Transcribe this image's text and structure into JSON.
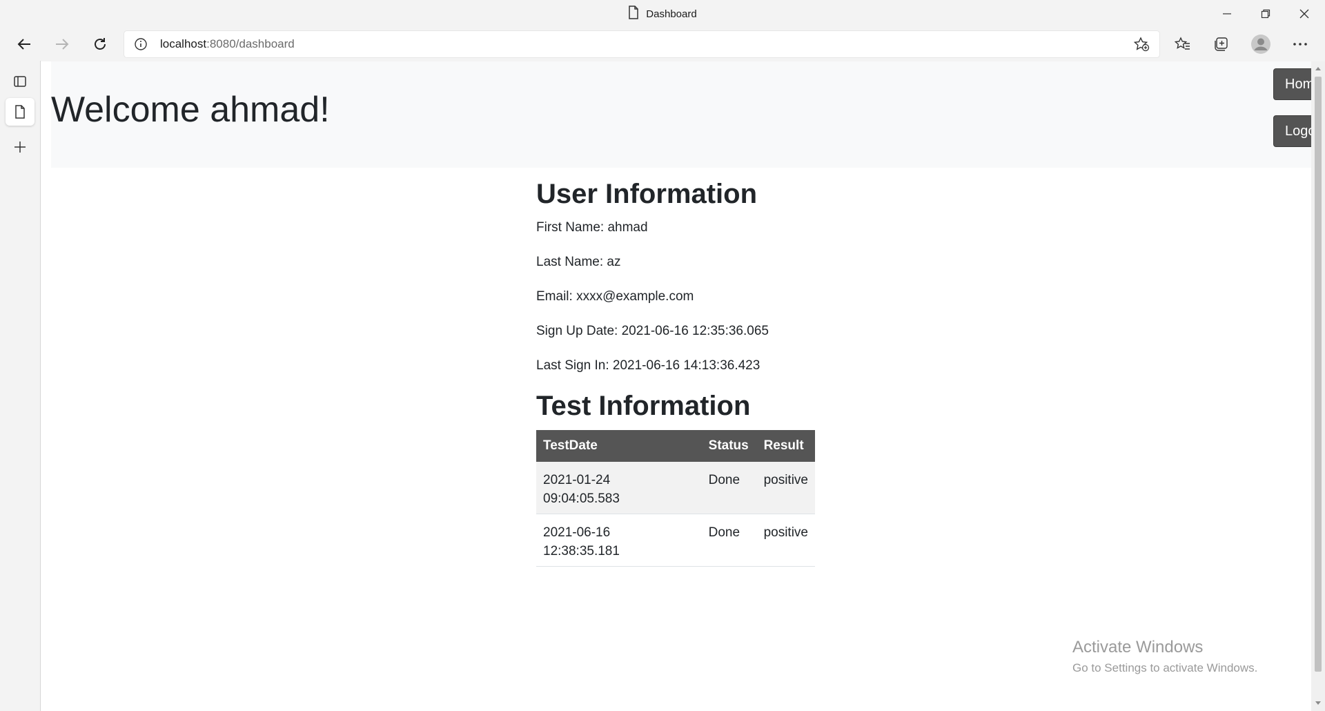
{
  "browser": {
    "tab_title": "Dashboard",
    "url_host": "localhost",
    "url_path": ":8080/dashboard"
  },
  "page": {
    "welcome": "Welcome ahmad!",
    "home_button": "Home",
    "logout_button": "Logout!",
    "user_info_heading": "User Information",
    "first_name": "First Name: ahmad",
    "last_name": "Last Name: az",
    "email": "Email: xxxx@example.com",
    "sign_up": "Sign Up Date: 2021-06-16 12:35:36.065",
    "last_sign_in": "Last Sign In: 2021-06-16 14:13:36.423",
    "test_info_heading": "Test Information",
    "table": {
      "headers": [
        "TestDate",
        "Status",
        "Result"
      ],
      "rows": [
        {
          "date_line1": "2021-01-24",
          "date_line2": "09:04:05.583",
          "status": "Done",
          "result": "positive"
        },
        {
          "date_line1": "2021-06-16",
          "date_line2": "12:38:35.181",
          "status": "Done",
          "result": "positive"
        }
      ]
    }
  },
  "watermark": {
    "line1": "Activate Windows",
    "line2": "Go to Settings to activate Windows."
  },
  "colors": {
    "button_bg": "#545454",
    "table_header_bg": "#555555",
    "header_bg": "#f8f9fa"
  }
}
